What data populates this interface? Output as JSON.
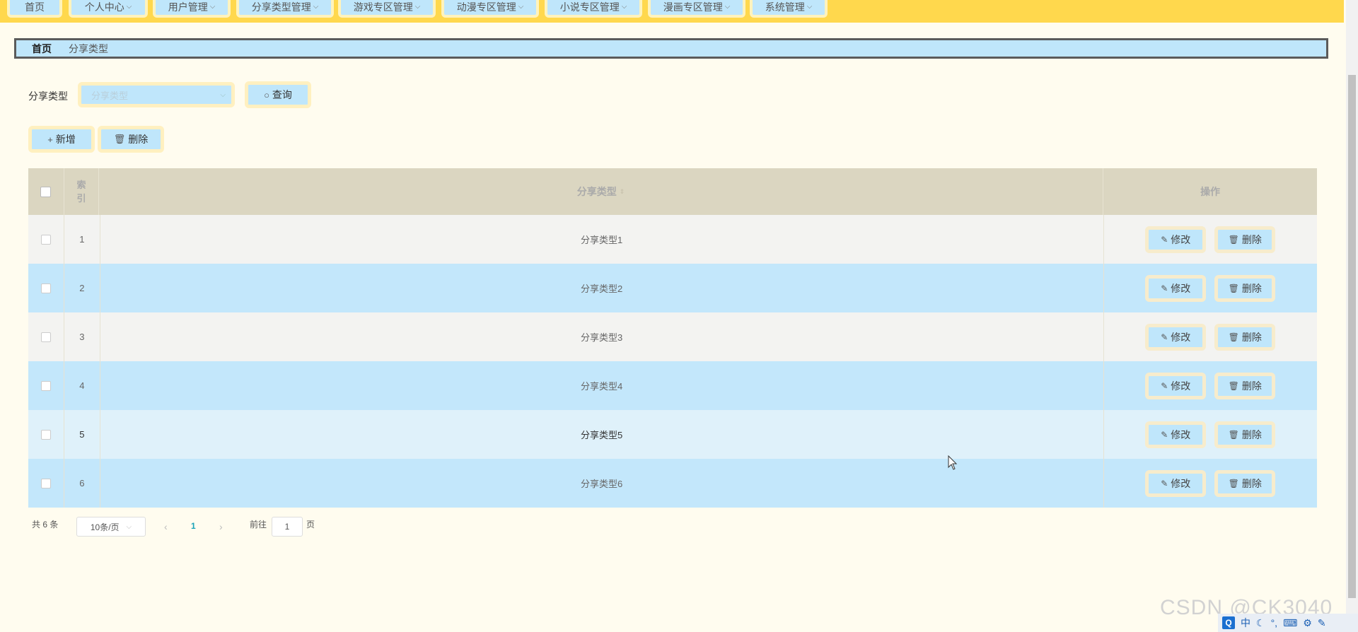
{
  "nav": {
    "items": [
      {
        "label": "首页",
        "has_dropdown": false
      },
      {
        "label": "个人中心",
        "has_dropdown": true
      },
      {
        "label": "用户管理",
        "has_dropdown": true
      },
      {
        "label": "分享类型管理",
        "has_dropdown": true
      },
      {
        "label": "游戏专区管理",
        "has_dropdown": true
      },
      {
        "label": "动漫专区管理",
        "has_dropdown": true
      },
      {
        "label": "小说专区管理",
        "has_dropdown": true
      },
      {
        "label": "漫画专区管理",
        "has_dropdown": true
      },
      {
        "label": "系统管理",
        "has_dropdown": true
      }
    ]
  },
  "breadcrumb": {
    "home": "首页",
    "current": "分享类型"
  },
  "search": {
    "label": "分享类型",
    "placeholder": "分享类型",
    "query_button": "查询"
  },
  "actions": {
    "add": "新增",
    "delete": "删除"
  },
  "table": {
    "headers": {
      "index": "索引",
      "type": "分享类型",
      "ops": "操作"
    },
    "rows": [
      {
        "index": "1",
        "type": "分享类型1"
      },
      {
        "index": "2",
        "type": "分享类型2"
      },
      {
        "index": "3",
        "type": "分享类型3"
      },
      {
        "index": "4",
        "type": "分享类型4"
      },
      {
        "index": "5",
        "type": "分享类型5"
      },
      {
        "index": "6",
        "type": "分享类型6"
      }
    ],
    "row_buttons": {
      "edit": "修改",
      "delete": "删除"
    }
  },
  "pagination": {
    "total_prefix": "共",
    "total": "6",
    "total_suffix": "条",
    "page_size": "10条/页",
    "current_page": "1",
    "goto_label": "前往",
    "goto_value": "1",
    "goto_suffix": "页"
  },
  "watermark": "CSDN @CK3040",
  "tray": {
    "ime": "中"
  },
  "colors": {
    "topbar": "#ffd84d",
    "accent": "#bfe6fb",
    "table_header": "#dbd6c1",
    "row_alt": "#c3e7fb",
    "page_bg": "#fffcef"
  }
}
